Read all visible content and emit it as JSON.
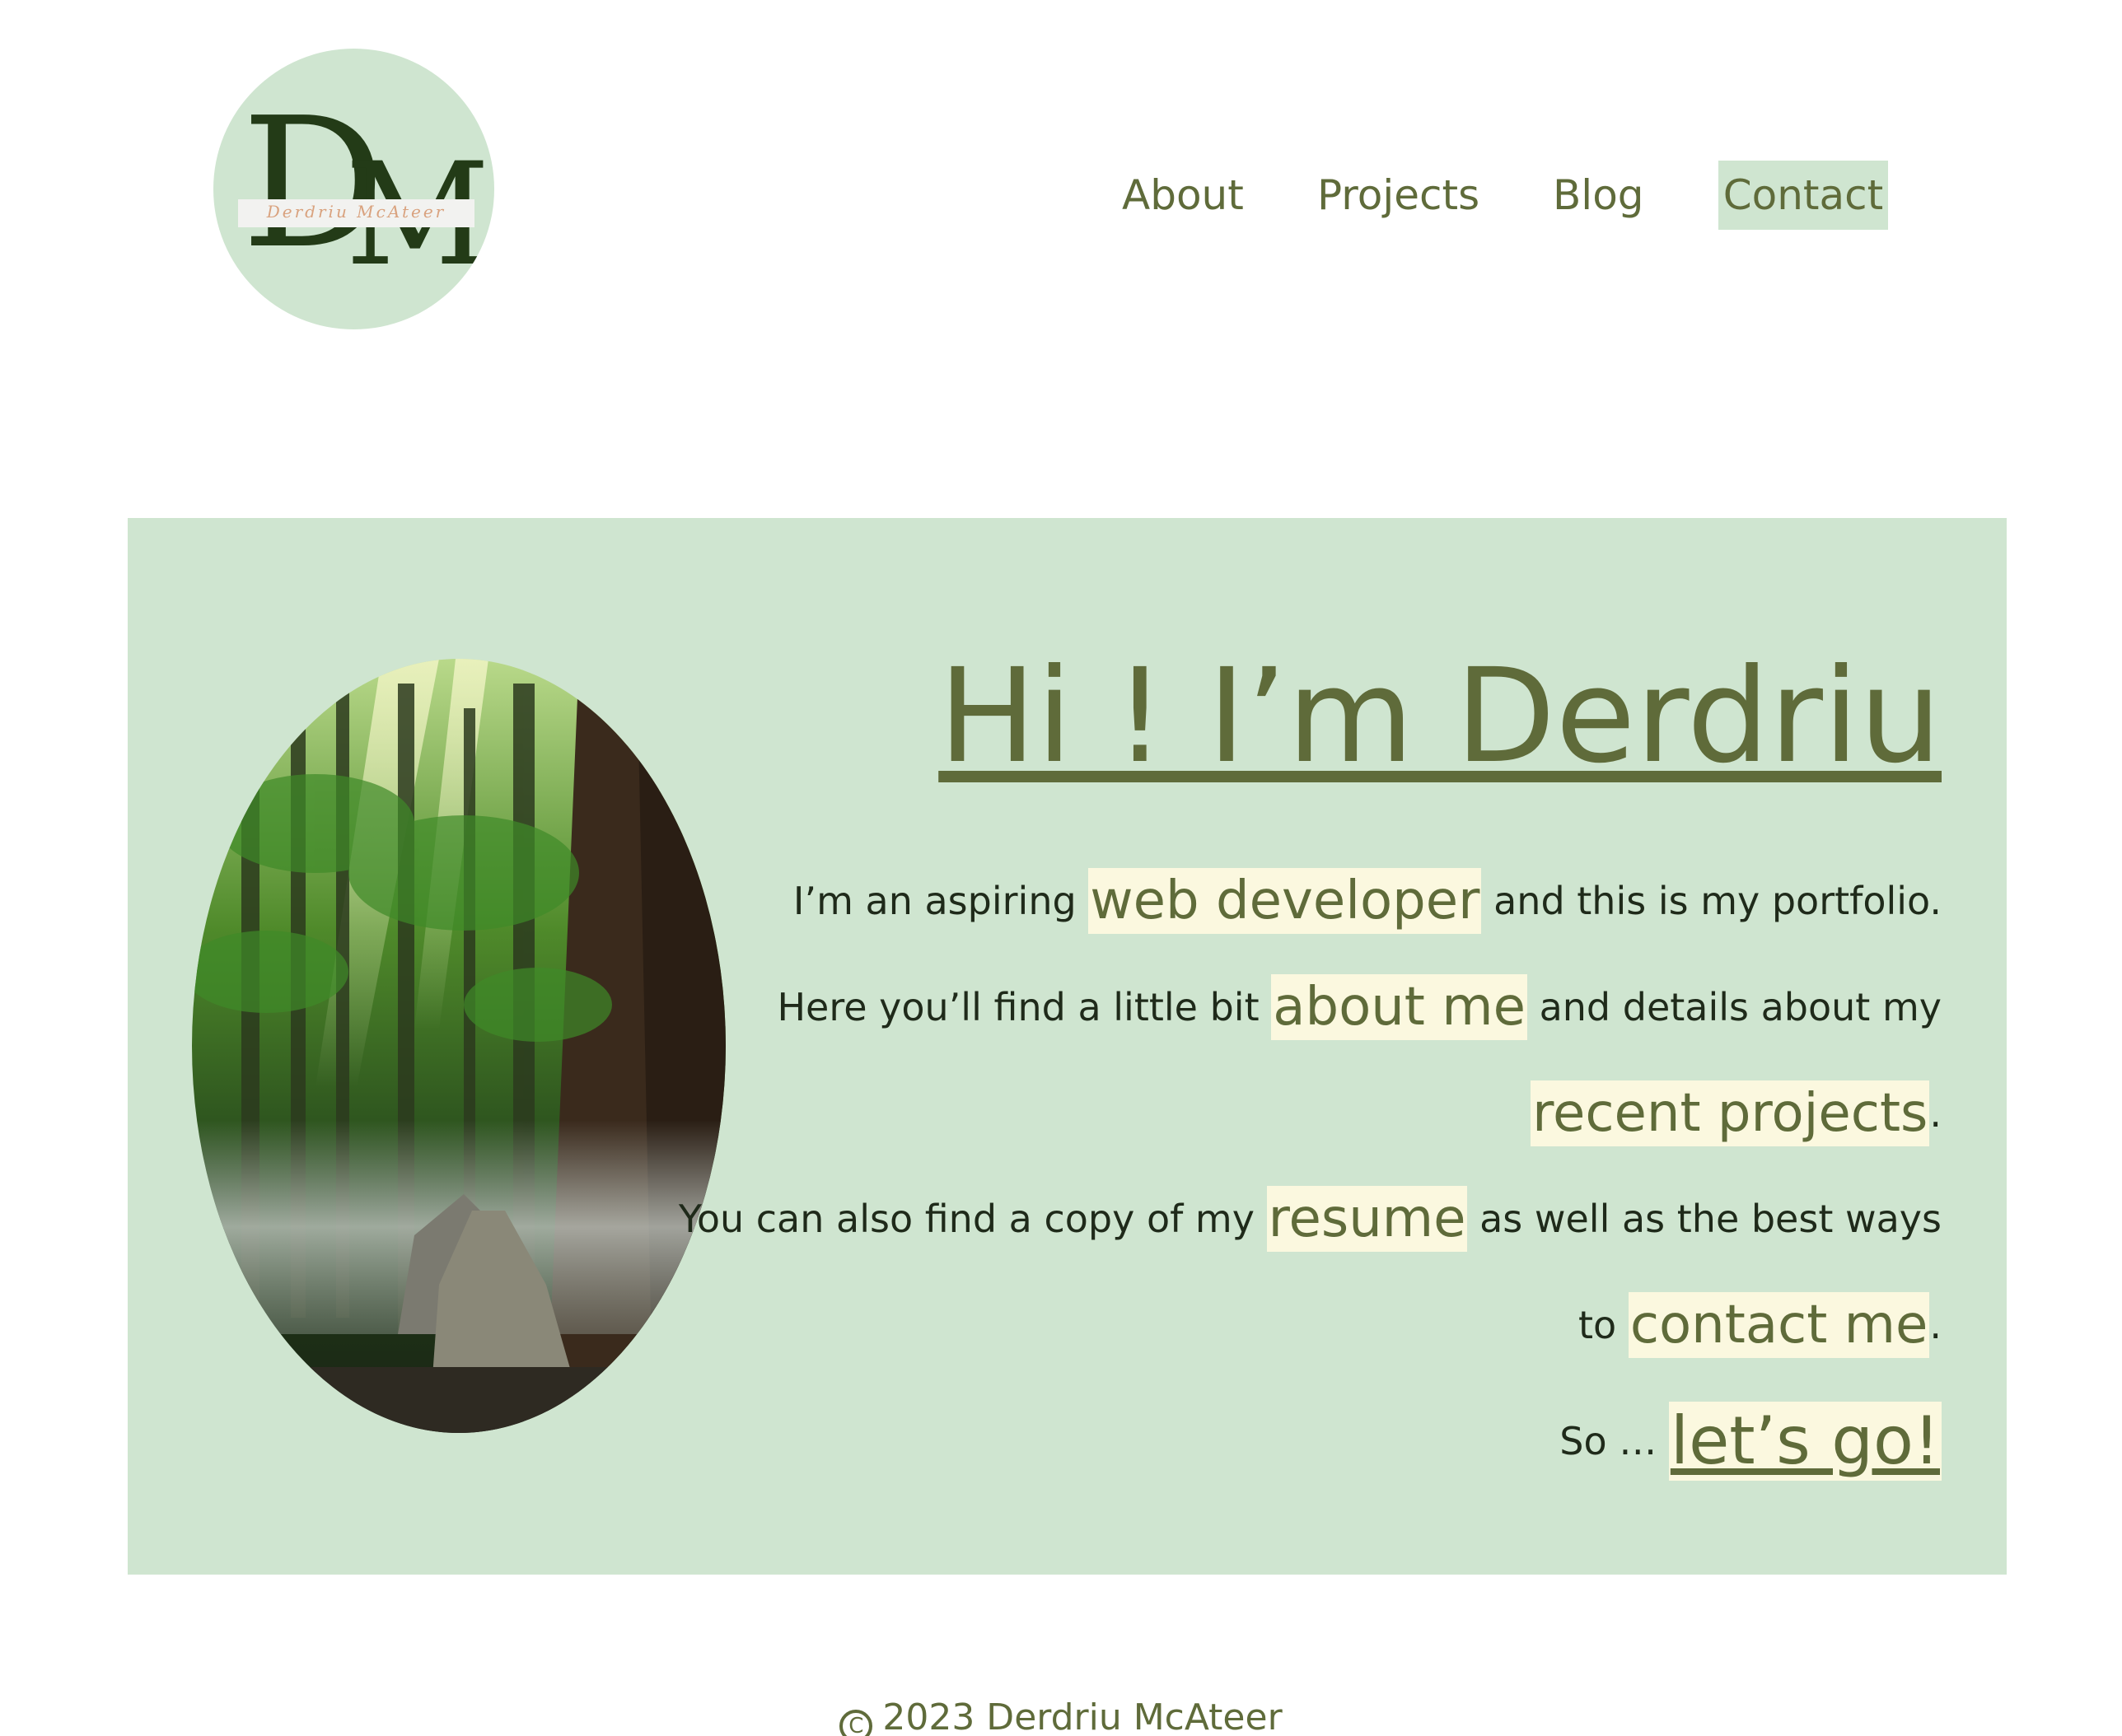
{
  "header": {
    "logo": {
      "letter_d": "D",
      "letter_m": "M",
      "script_name": "Derdriu McAteer"
    },
    "nav": {
      "about": "About",
      "projects": "Projects",
      "blog": "Blog",
      "contact": "Contact",
      "active": "Contact"
    }
  },
  "hero": {
    "headline": "Hi ! I’m Derdriu",
    "image_icon": "forest-photo",
    "line1": {
      "before": "I’m an aspiring ",
      "highlight": "web developer",
      "after": " and this is my portfolio."
    },
    "line2": {
      "before": "Here you’ll find a little bit ",
      "highlight": "about me",
      "after": " and details about my"
    },
    "line3": {
      "highlight": "recent projects",
      "after": "."
    },
    "line4": {
      "before": "You can also find a copy of my ",
      "highlight": "resume",
      "after": " as well as the best ways"
    },
    "line5": {
      "before": "to ",
      "highlight": "contact me",
      "after": "."
    },
    "line6": {
      "before": "So … ",
      "highlight": "let’s go!"
    }
  },
  "footer": {
    "icon": "copyright-icon",
    "copyright_symbol": "C",
    "text": "2023 Derdriu McAteer"
  },
  "colors": {
    "accent_green": "#cfe5d0",
    "text_olive": "#5f6b3a",
    "highlight_cream": "#fbf8df",
    "logo_dark": "#233b17"
  }
}
